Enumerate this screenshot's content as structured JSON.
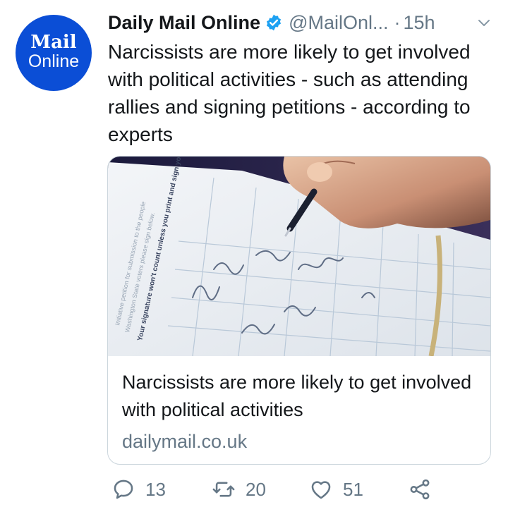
{
  "tweet": {
    "avatar": {
      "line1": "Mail",
      "line2": "Online",
      "color": "#0b4ed6"
    },
    "author_name": "Daily Mail Online",
    "handle": "@MailOnl...",
    "separator": "·",
    "time": "15h",
    "text": "Narcissists are more likely to get involved with political activities - such as attending rallies and signing petitions - according to experts",
    "card": {
      "title": "Narcissists are more likely to get involved with political activities",
      "domain": "dailymail.co.uk",
      "image_text": "Your signature won't count unless you print and sign your name clearly"
    },
    "actions": {
      "replies": "13",
      "retweets": "20",
      "likes": "51"
    }
  },
  "icons": [
    "verified-icon",
    "chevron-down-icon",
    "reply-icon",
    "retweet-icon",
    "like-icon",
    "share-icon"
  ],
  "colors": {
    "accent": "#1da1f2",
    "text": "#14171a",
    "secondary": "#657786",
    "border": "#ccd6dd"
  }
}
